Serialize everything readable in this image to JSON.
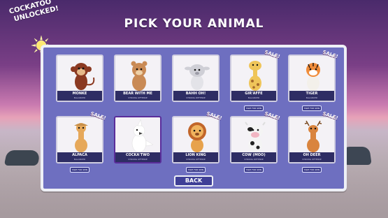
{
  "header": {
    "title": "PICK YOUR ANIMAL"
  },
  "unlock_banner": {
    "line1": "COCKATOO",
    "line2": "UNLOCKED!"
  },
  "back_label": "BACK",
  "animals": [
    {
      "name": "MONKE",
      "sub": "BALANCED",
      "sale": "",
      "tryout": "",
      "selected": false
    },
    {
      "name": "BEAR WITH ME",
      "sub": "STRONG OFFENSE",
      "sale": "",
      "tryout": "",
      "selected": false
    },
    {
      "name": "BAHH OH!",
      "sub": "STRONG DEFENSE",
      "sale": "",
      "tryout": "",
      "selected": false
    },
    {
      "name": "GIR'AFFE",
      "sub": "BALANCED",
      "sale": "SALE!",
      "tryout": "TAKE FOR SPIN",
      "selected": false
    },
    {
      "name": "TIGER",
      "sub": "BALANCED",
      "sale": "SALE!",
      "tryout": "TAKE FOR SPIN",
      "selected": false
    },
    {
      "name": "ALPACA",
      "sub": "BALANCED",
      "sale": "SALE!",
      "tryout": "TAKE FOR SPIN",
      "selected": false
    },
    {
      "name": "COCKA'TWO",
      "sub": "STRONG OFFENSE",
      "sale": "",
      "tryout": "",
      "selected": true
    },
    {
      "name": "LION KING",
      "sub": "STRONG OFFENSE",
      "sale": "SALE!",
      "tryout": "TAKE FOR SPIN",
      "selected": false
    },
    {
      "name": "COW (MOO)",
      "sub": "STRONG DEFENSE",
      "sale": "SALE!",
      "tryout": "TAKE FOR SPIN",
      "selected": false
    },
    {
      "name": "OH DEER",
      "sub": "STRONG OFFENSE",
      "sale": "SALE!",
      "tryout": "TAKE FOR SPIN",
      "selected": false
    }
  ],
  "colors": {
    "panel": "#6e6fc0",
    "label_bar": "#2e2d64",
    "selected_border": "#5a2d9a"
  }
}
